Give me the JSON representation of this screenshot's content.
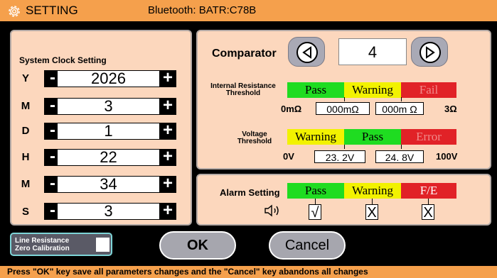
{
  "titlebar": {
    "title": "SETTING",
    "bluetooth": "Bluetooth: BATR:C78B"
  },
  "clock": {
    "heading": "System Clock Setting",
    "rows": [
      {
        "label": "Y",
        "value": "2026"
      },
      {
        "label": "M",
        "value": "3"
      },
      {
        "label": "D",
        "value": "1"
      },
      {
        "label": "H",
        "value": "22"
      },
      {
        "label": "M",
        "value": "34"
      },
      {
        "label": "S",
        "value": "3"
      }
    ],
    "minus": "-",
    "plus": "+"
  },
  "comparator": {
    "label": "Comparator",
    "value": "4"
  },
  "resistance": {
    "label_line1": "Internal Resistance",
    "label_line2": "Threshold",
    "segments": [
      "Pass",
      "Warning",
      "Fail"
    ],
    "min": "0mΩ",
    "low": "000mΩ",
    "high": "000m Ω",
    "max": "3Ω"
  },
  "voltage": {
    "label_line1": "Voltage",
    "label_line2": "Threshold",
    "segments": [
      "Warning",
      "Pass",
      "Error"
    ],
    "min": "0V",
    "low": "23. 2V",
    "high": "24. 8V",
    "max": "100V"
  },
  "alarm": {
    "label": "Alarm Setting",
    "segments": [
      "Pass",
      "Warning",
      "F/E"
    ],
    "marks": [
      "√",
      "X",
      "X"
    ]
  },
  "line_resistance": {
    "line1": "Line Resistance",
    "line2": "Zero Calibration"
  },
  "buttons": {
    "ok": "OK",
    "cancel": "Cancel"
  },
  "footer": "Press \"OK\" key save all parameters changes and the \"Cancel\" key abandons all changes",
  "colors": {
    "titlebar": "#f5a04c",
    "panel": "#fcd7bd",
    "pass": "#1fdc21",
    "warning": "#f2f200",
    "fail": "#e12227"
  }
}
